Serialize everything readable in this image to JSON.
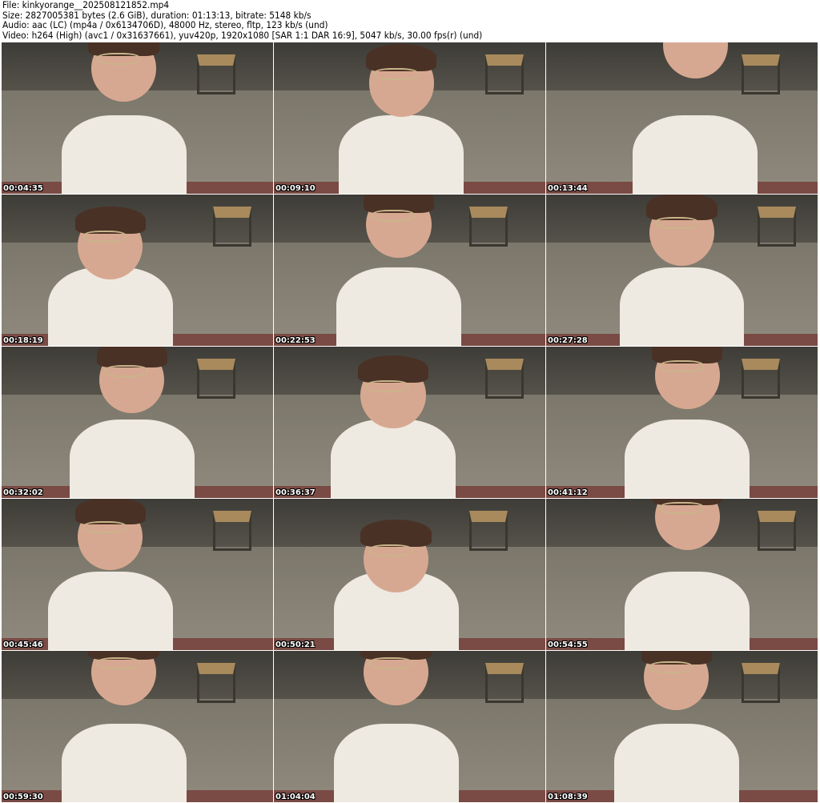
{
  "header": {
    "file": "File: kinkyorange__202508121852.mp4",
    "size": "Size: 2827005381 bytes (2.6 GiB), duration: 01:13:13, bitrate: 5148 kb/s",
    "audio": "Audio: aac (LC) (mp4a / 0x6134706D), 48000 Hz, stereo, fltp, 123 kb/s (und)",
    "video": "Video: h264 (High) (avc1 / 0x31637661), yuv420p, 1920x1080 [SAR 1:1 DAR 16:9], 5047 kb/s, 30.00 fps(r) (und)"
  },
  "thumbnails": [
    {
      "timestamp": "00:04:35"
    },
    {
      "timestamp": "00:09:10"
    },
    {
      "timestamp": "00:13:44"
    },
    {
      "timestamp": "00:18:19"
    },
    {
      "timestamp": "00:22:53"
    },
    {
      "timestamp": "00:27:28"
    },
    {
      "timestamp": "00:32:02"
    },
    {
      "timestamp": "00:36:37"
    },
    {
      "timestamp": "00:41:12"
    },
    {
      "timestamp": "00:45:46"
    },
    {
      "timestamp": "00:50:21"
    },
    {
      "timestamp": "00:54:55"
    },
    {
      "timestamp": "00:59:30"
    },
    {
      "timestamp": "01:04:04"
    },
    {
      "timestamp": "01:08:39"
    }
  ]
}
